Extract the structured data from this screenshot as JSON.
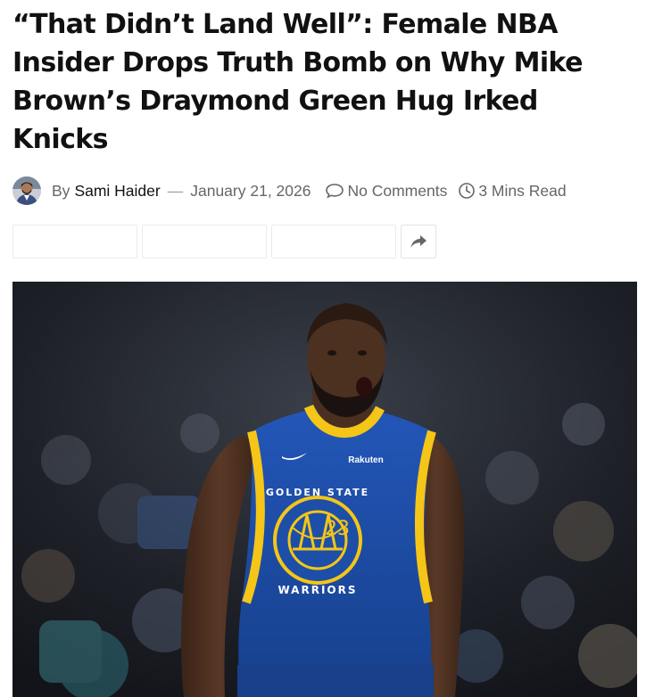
{
  "article": {
    "headline": "“That Didn’t Land Well”: Female NBA Insider Drops Truth Bomb on Why Mike Brown’s Draymond Green Hug Irked Knicks"
  },
  "meta": {
    "by_label": "By",
    "author": "Sami Haider",
    "separator": "—",
    "date": "January 21, 2026",
    "comments": "No Comments",
    "read_time": "3 Mins Read",
    "icons": {
      "comments": "speech-bubble-icon",
      "read_time": "clock-icon",
      "share": "share-arrow-icon"
    }
  },
  "jersey": {
    "sponsor": "Rakuten",
    "top_text": "GOLDEN STATE",
    "number": "23",
    "bottom_text": "WARRIORS"
  },
  "colors": {
    "headline": "#111111",
    "meta": "#666666",
    "jersey_blue": "#1d4fa8",
    "jersey_gold": "#f5c518"
  }
}
